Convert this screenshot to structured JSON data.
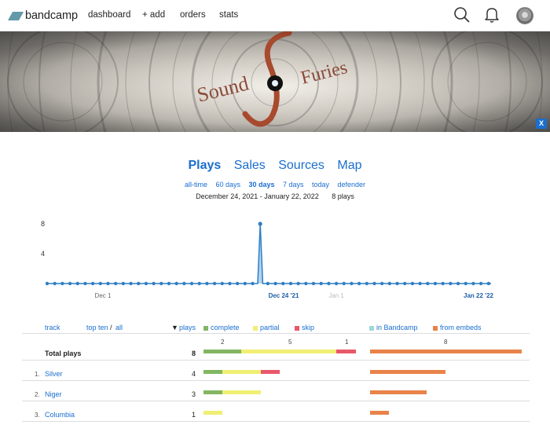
{
  "nav": {
    "logo_text": "bandcamp",
    "links": [
      "dashboard",
      "+ add",
      "orders",
      "stats"
    ],
    "icons": [
      "search-icon",
      "bell-icon",
      "avatar"
    ]
  },
  "banner": {
    "title_text": "Sound Furies",
    "close_label": "X"
  },
  "stats": {
    "tabs": [
      "Plays",
      "Sales",
      "Sources",
      "Map"
    ],
    "active_tab": "Plays",
    "ranges": [
      "all-time",
      "60 days",
      "30 days",
      "7 days",
      "today",
      "defender"
    ],
    "active_range": "30 days",
    "date_range": "December 24, 2021 - January 22, 2022",
    "total_plays_label": "8 plays"
  },
  "chart_data": {
    "type": "area",
    "y_ticks": [
      "8",
      "4"
    ],
    "ylim": [
      0,
      8
    ],
    "x_labels": [
      "Dec 1",
      "Dec 24 '21",
      "Jan 1",
      "Jan 22 '22"
    ],
    "series": [
      {
        "values": [
          0,
          0,
          0,
          0,
          0,
          0,
          0,
          0,
          0,
          0,
          0,
          0,
          0,
          0,
          0,
          0,
          0,
          0,
          0,
          0,
          0,
          0,
          0,
          0,
          0,
          0,
          0,
          0,
          0,
          0,
          0,
          0,
          0,
          0,
          0,
          0,
          0,
          0,
          0,
          0,
          0,
          0,
          0,
          0,
          0,
          0,
          0,
          0,
          0,
          0,
          0,
          0,
          0,
          0,
          0,
          0,
          0,
          0,
          0,
          0,
          0,
          0,
          0,
          0,
          0,
          0,
          0,
          0,
          0,
          0,
          0,
          0,
          0,
          0,
          0,
          0,
          0,
          0,
          0,
          0,
          0,
          0,
          0,
          0,
          8,
          0,
          0,
          0,
          0,
          0,
          0,
          0,
          0,
          0,
          0,
          0,
          0,
          0,
          0,
          0,
          0,
          0,
          0,
          0,
          0,
          0,
          0,
          0,
          0,
          0,
          0,
          0,
          0,
          0,
          0,
          0,
          0,
          0,
          0,
          0,
          0,
          0,
          0,
          0,
          0,
          0,
          0,
          0,
          0,
          0,
          0,
          0,
          0,
          0,
          0,
          0,
          0,
          0,
          0,
          0,
          0,
          0,
          0,
          0,
          0,
          0,
          0,
          0,
          0,
          0,
          0,
          0,
          0,
          0,
          0,
          0,
          0,
          0,
          0,
          0,
          0,
          0,
          0,
          0,
          0,
          0,
          0,
          0,
          0,
          0,
          0,
          0,
          0,
          0,
          0,
          0
        ]
      }
    ],
    "peak_value": 8
  },
  "table": {
    "headers": {
      "track": "track",
      "top_ten": "top ten",
      "separator": "/",
      "all": "all",
      "plays": "plays",
      "complete": "complete",
      "partial": "partial",
      "skip": "skip",
      "in_bandcamp": "in Bandcamp",
      "from_embeds": "from embeds"
    },
    "colors": {
      "complete": "#82b662",
      "partial": "#f0ef74",
      "skip": "#e9586a",
      "in_bandcamp": "#9fd8da",
      "from_embeds": "#e8834a"
    },
    "summary_counts": {
      "complete": "2",
      "partial": "5",
      "skip": "1",
      "from_embeds": "8"
    },
    "total": {
      "label": "Total plays",
      "plays": "8",
      "complete": 2,
      "partial": 5,
      "skip": 1,
      "in_bandcamp": 0,
      "from_embeds": 8
    },
    "rows": [
      {
        "rank": "1.",
        "name": "Silver",
        "plays": "4",
        "complete": 1,
        "partial": 2,
        "skip": 1,
        "in_bandcamp": 0,
        "from_embeds": 4
      },
      {
        "rank": "2.",
        "name": "Niger",
        "plays": "3",
        "complete": 1,
        "partial": 2,
        "skip": 0,
        "in_bandcamp": 0,
        "from_embeds": 3
      },
      {
        "rank": "3.",
        "name": "Columbia",
        "plays": "1",
        "complete": 0,
        "partial": 1,
        "skip": 0,
        "in_bandcamp": 0,
        "from_embeds": 1
      }
    ]
  }
}
